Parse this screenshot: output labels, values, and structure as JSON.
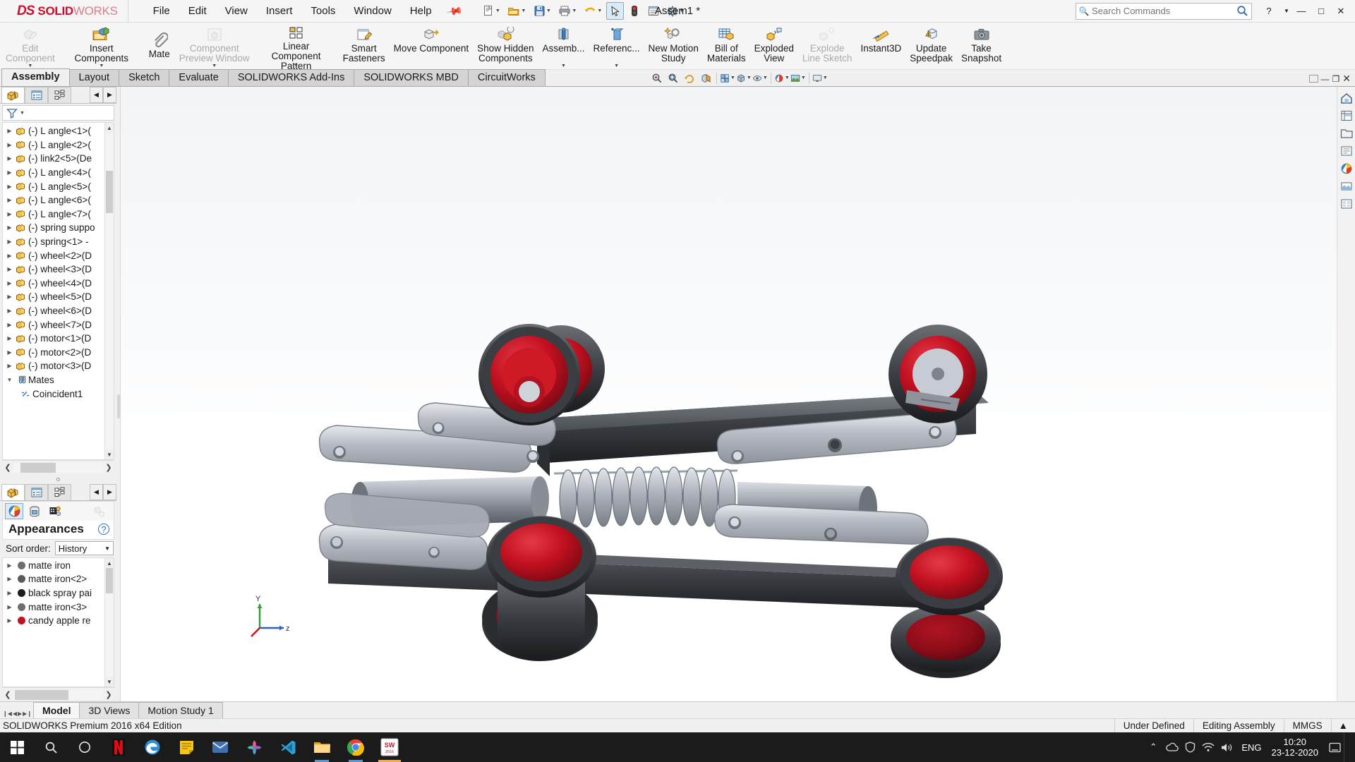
{
  "titlebar": {
    "logo_ds": "DS",
    "logo_solid": "SOLID",
    "logo_works": "WORKS",
    "document_title": "Assem1 *",
    "menu": [
      "File",
      "Edit",
      "View",
      "Insert",
      "Tools",
      "Window",
      "Help"
    ],
    "pin_icon": "pushpin-icon",
    "quick_tools": [
      {
        "name": "new-document",
        "glyph": "new-doc-icon"
      },
      {
        "name": "open-document",
        "glyph": "open-folder-icon"
      },
      {
        "name": "save",
        "glyph": "floppy-disk-icon"
      },
      {
        "name": "print",
        "glyph": "printer-icon"
      },
      {
        "name": "undo",
        "glyph": "undo-arrow-icon"
      },
      {
        "name": "select",
        "glyph": "cursor-arrow-icon"
      },
      {
        "name": "rebuild",
        "glyph": "traffic-light-icon"
      },
      {
        "name": "file-properties",
        "glyph": "properties-icon"
      },
      {
        "name": "options",
        "glyph": "gear-icon"
      }
    ],
    "search": {
      "placeholder": "Search Commands",
      "value": ""
    },
    "help_label": "?",
    "window_buttons": {
      "minimize": "—",
      "maximize": "□",
      "close": "✕"
    }
  },
  "ribbon": {
    "buttons": [
      {
        "label": "Edit\nComponent",
        "icon": "edit-component-icon",
        "disabled": true,
        "caret": true
      },
      {
        "label": "Insert Components",
        "icon": "insert-components-icon",
        "disabled": false,
        "caret": true
      },
      {
        "label": "Mate",
        "icon": "paperclip-mate-icon",
        "disabled": false,
        "caret": false
      },
      {
        "label": "Component\nPreview Window",
        "icon": "component-preview-icon",
        "disabled": true,
        "caret": true
      },
      {
        "label": "Linear Component Pattern",
        "icon": "linear-pattern-icon",
        "disabled": false,
        "caret": true
      },
      {
        "label": "Smart\nFasteners",
        "icon": "smart-fasteners-icon",
        "disabled": false,
        "caret": false
      },
      {
        "label": "Move Component",
        "icon": "move-component-icon",
        "disabled": false,
        "caret": false
      },
      {
        "label": "Show Hidden\nComponents",
        "icon": "show-hidden-components-icon",
        "disabled": false,
        "caret": false
      },
      {
        "label": "Assemb...",
        "icon": "assembly-features-icon",
        "disabled": false,
        "caret": true
      },
      {
        "label": "Referenc...",
        "icon": "reference-geometry-icon",
        "disabled": false,
        "caret": true
      },
      {
        "label": "New Motion\nStudy",
        "icon": "new-motion-study-icon",
        "disabled": false,
        "caret": false
      },
      {
        "label": "Bill of\nMaterials",
        "icon": "bill-of-materials-icon",
        "disabled": false,
        "caret": false
      },
      {
        "label": "Exploded\nView",
        "icon": "exploded-view-icon",
        "disabled": false,
        "caret": false
      },
      {
        "label": "Explode\nLine Sketch",
        "icon": "explode-line-sketch-icon",
        "disabled": true,
        "caret": false
      },
      {
        "label": "Instant3D",
        "icon": "instant3d-ruler-icon",
        "disabled": false,
        "caret": false
      },
      {
        "label": "Update\nSpeedpak",
        "icon": "update-speedpak-icon",
        "disabled": false,
        "caret": false
      },
      {
        "label": "Take\nSnapshot",
        "icon": "camera-snapshot-icon",
        "disabled": false,
        "caret": false
      }
    ]
  },
  "command_tabs": {
    "tabs": [
      "Assembly",
      "Layout",
      "Sketch",
      "Evaluate",
      "SOLIDWORKS Add-Ins",
      "SOLIDWORKS MBD",
      "CircuitWorks"
    ],
    "active": "Assembly",
    "view_tools": [
      {
        "name": "zoom-to-fit-icon"
      },
      {
        "name": "zoom-to-area-icon"
      },
      {
        "name": "previous-view-icon"
      },
      {
        "name": "section-view-icon"
      },
      {
        "name": "view-orientation-icon"
      },
      {
        "name": "display-style-icon"
      },
      {
        "name": "hide-show-items-icon"
      },
      {
        "name": "edit-appearance-icon"
      },
      {
        "name": "apply-scene-icon"
      },
      {
        "name": "view-settings-icon"
      }
    ],
    "window_controls": [
      "restore-down-icon",
      "minimize-icon",
      "maximize-icon",
      "close-icon"
    ]
  },
  "feature_tree": {
    "panel_tabs": [
      "feature-manager-tab",
      "property-manager-tab",
      "configuration-manager-tab"
    ],
    "filter_placeholder": "",
    "items": [
      {
        "label": "(-) L angle<1>",
        "suffix": " (",
        "expandable": true,
        "icon": "component-icon"
      },
      {
        "label": "(-) L angle<2>",
        "suffix": " (",
        "expandable": true,
        "icon": "component-icon"
      },
      {
        "label": "(-) link2<5>",
        "suffix": " (De",
        "expandable": true,
        "icon": "component-icon"
      },
      {
        "label": "(-) L angle<4>",
        "suffix": " (",
        "expandable": true,
        "icon": "component-icon"
      },
      {
        "label": "(-) L angle<5>",
        "suffix": " (",
        "expandable": true,
        "icon": "component-icon"
      },
      {
        "label": "(-) L angle<6>",
        "suffix": " (",
        "expandable": true,
        "icon": "component-icon"
      },
      {
        "label": "(-) L angle<7>",
        "suffix": " (",
        "expandable": true,
        "icon": "component-icon"
      },
      {
        "label": "(-) spring suppo",
        "suffix": "",
        "expandable": true,
        "icon": "component-icon"
      },
      {
        "label": "(-) spring<1> -",
        "suffix": "",
        "expandable": true,
        "icon": "component-icon"
      },
      {
        "label": "(-) wheel<2>",
        "suffix": " (D",
        "expandable": true,
        "icon": "component-icon"
      },
      {
        "label": "(-) wheel<3>",
        "suffix": " (D",
        "expandable": true,
        "icon": "component-icon"
      },
      {
        "label": "(-) wheel<4>",
        "suffix": " (D",
        "expandable": true,
        "icon": "component-icon"
      },
      {
        "label": "(-) wheel<5>",
        "suffix": " (D",
        "expandable": true,
        "icon": "component-icon"
      },
      {
        "label": "(-) wheel<6>",
        "suffix": " (D",
        "expandable": true,
        "icon": "component-icon"
      },
      {
        "label": "(-) wheel<7>",
        "suffix": " (D",
        "expandable": true,
        "icon": "component-icon"
      },
      {
        "label": "(-) motor<1>",
        "suffix": " (D",
        "expandable": true,
        "icon": "component-icon"
      },
      {
        "label": "(-) motor<2>",
        "suffix": " (D",
        "expandable": true,
        "icon": "component-icon"
      },
      {
        "label": "(-) motor<3>",
        "suffix": " (D",
        "expandable": true,
        "icon": "component-icon"
      },
      {
        "label": "Mates",
        "suffix": "",
        "expandable": true,
        "expanded": true,
        "icon": "mates-paperclip-icon"
      },
      {
        "label": "Coincident1",
        "suffix": "",
        "expandable": false,
        "indent": true,
        "icon": "coincident-mate-icon"
      }
    ]
  },
  "appearances": {
    "title": "Appearances",
    "help_glyph": "?",
    "tabs": [
      "appearances-tab",
      "scenes-tab",
      "decals-tab"
    ],
    "sort_label": "Sort order:",
    "sort_value": "History",
    "items": [
      {
        "label": "matte iron",
        "color": "#6e6e6e"
      },
      {
        "label": "matte iron<2>",
        "color": "#5a5a5a"
      },
      {
        "label": "black spray pai",
        "color": "#1d1d1d"
      },
      {
        "label": "matte iron<3>",
        "color": "#6e6e6e"
      },
      {
        "label": "candy apple re",
        "color": "#c1121f"
      }
    ]
  },
  "viewport": {
    "triad": {
      "x_label": "z",
      "y_label": "Y"
    },
    "right_dock": [
      {
        "name": "view-orientation-home-icon"
      },
      {
        "name": "display-manager-icon"
      },
      {
        "name": "open-folder-icon"
      },
      {
        "name": "appearance-list-icon"
      },
      {
        "name": "color-wheel-icon"
      },
      {
        "name": "scene-icon"
      },
      {
        "name": "render-tools-icon"
      }
    ]
  },
  "model_tabs": {
    "tabs": [
      "Model",
      "3D Views",
      "Motion Study 1"
    ],
    "active": "Model"
  },
  "statusbar": {
    "edition": "SOLIDWORKS Premium 2016 x64 Edition",
    "state": "Under Defined",
    "mode": "Editing Assembly",
    "units": "MMGS",
    "expand_glyph": "▲"
  },
  "taskbar": {
    "start": "windows-start-icon",
    "search": "search-icon",
    "task_view": "task-view-icon",
    "apps": [
      {
        "name": "netflix-icon",
        "label": "N",
        "color": "#e50914",
        "bg": "#111111",
        "running": false
      },
      {
        "name": "edge-browser-icon",
        "label": "",
        "color": "#2e8ed6",
        "bg": "",
        "running": false
      },
      {
        "name": "sticky-notes-icon",
        "label": "",
        "color": "#f5c518",
        "bg": "",
        "running": false
      },
      {
        "name": "mail-icon",
        "label": "",
        "color": "#2d6fb5",
        "bg": "",
        "running": false
      },
      {
        "name": "photos-icon",
        "label": "",
        "color": "#d93a7e",
        "bg": "",
        "running": false
      },
      {
        "name": "vs-code-icon",
        "label": "",
        "color": "#2f9fd6",
        "bg": "",
        "running": false
      },
      {
        "name": "file-explorer-icon",
        "label": "",
        "color": "#f2b53a",
        "bg": "",
        "running": true
      },
      {
        "name": "chrome-browser-icon",
        "label": "",
        "color": "#4285f4",
        "bg": "",
        "running": true
      },
      {
        "name": "solidworks-icon",
        "label": "SW",
        "color": "#ffffff",
        "bg": "#c8102e",
        "running": true,
        "active": true
      }
    ],
    "tray": [
      {
        "name": "show-hidden-icons-chevron"
      },
      {
        "name": "onedrive-icon"
      },
      {
        "name": "antivirus-shield-icon"
      },
      {
        "name": "volume-speaker-icon"
      },
      {
        "name": "network-wifi-icon"
      }
    ],
    "language": "ENG",
    "time": "10:20",
    "date": "23-12-2020",
    "action_center": "notification-icon"
  }
}
